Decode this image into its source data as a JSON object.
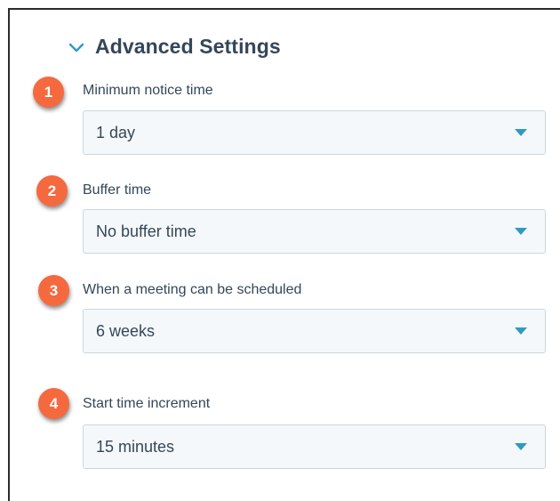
{
  "section": {
    "title": "Advanced Settings",
    "expanded_icon": "chevron-down-icon"
  },
  "fields": [
    {
      "badge": "1",
      "label": "Minimum notice time",
      "value": "1 day"
    },
    {
      "badge": "2",
      "label": "Buffer time",
      "value": "No buffer time"
    },
    {
      "badge": "3",
      "label": "When a meeting can be scheduled",
      "value": "6 weeks"
    },
    {
      "badge": "4",
      "label": "Start time increment",
      "value": "15 minutes"
    }
  ],
  "colors": {
    "badge": "#f5693f",
    "text": "#33475b",
    "accent": "#2d9cbe",
    "select_bg": "#f5f8fa",
    "select_border": "#cbd6e2"
  }
}
